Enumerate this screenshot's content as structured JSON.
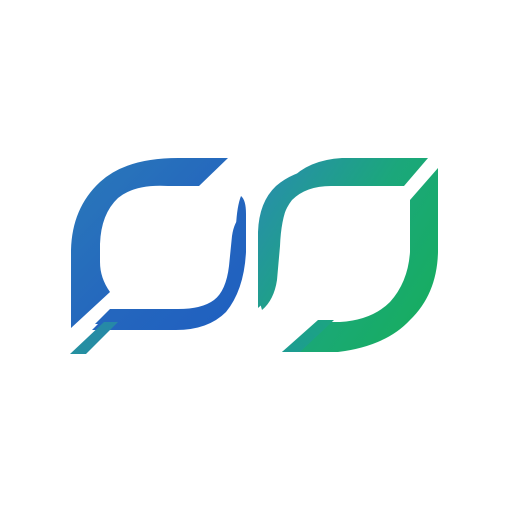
{
  "logo": {
    "icon": "infinity-loop-logo-icon",
    "colors": {
      "blue_dark": "#1F5FC0",
      "blue_mid": "#2A79B9",
      "teal": "#2590A0",
      "green_mid": "#1BA77B",
      "green_bright": "#16AE5C",
      "background": "#FFFFFF"
    }
  }
}
